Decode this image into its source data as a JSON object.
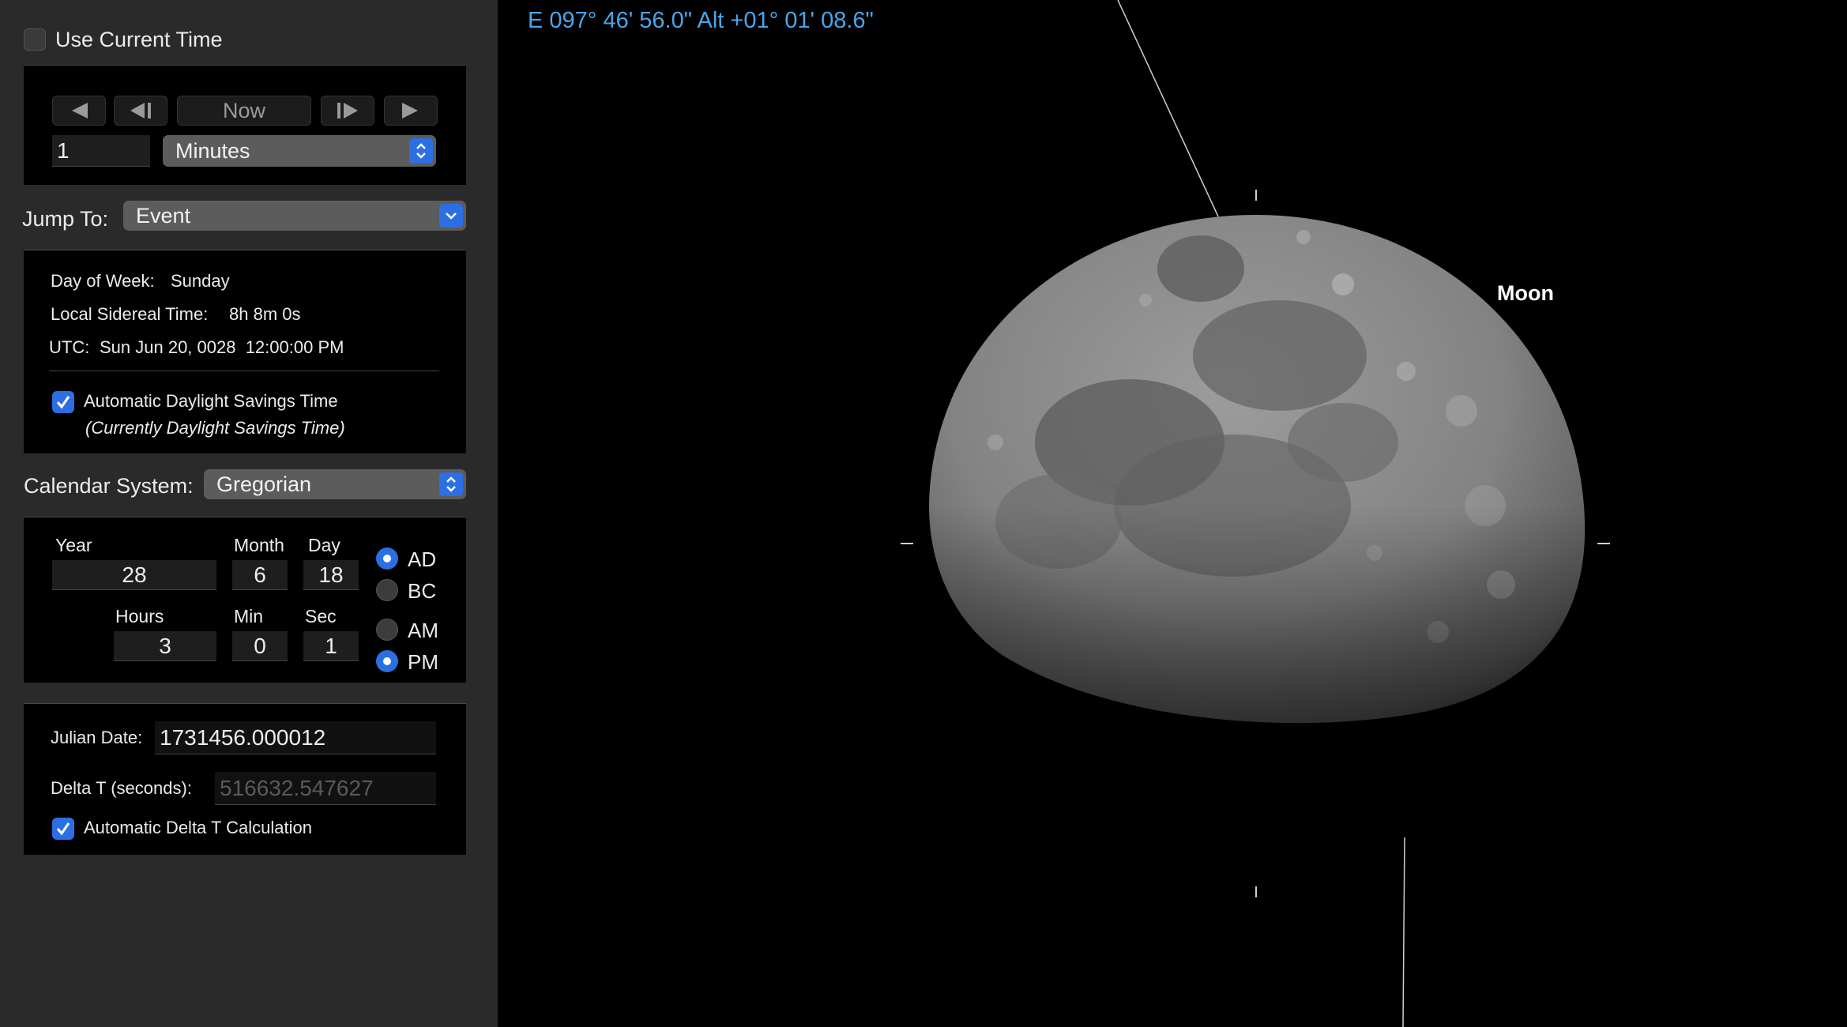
{
  "use_current_time": {
    "label": "Use Current Time",
    "checked": false
  },
  "step_controls": {
    "now_label": "Now",
    "step_amount": "1",
    "step_unit": "Minutes"
  },
  "jump_to": {
    "label": "Jump To:",
    "value": "Event"
  },
  "info": {
    "day_of_week_label": "Day of Week:",
    "day_of_week": "Sunday",
    "sidereal_label": "Local Sidereal Time:",
    "sidereal": "8h 8m 0s",
    "utc_label": "UTC:",
    "utc": "Sun Jun 20, 0028  12:00:00 PM",
    "auto_dst_label": "Automatic Daylight Savings Time",
    "auto_dst_checked": true,
    "dst_note": "(Currently Daylight Savings Time)"
  },
  "calendar": {
    "label": "Calendar System:",
    "value": "Gregorian"
  },
  "date": {
    "year_label": "Year",
    "year": "28",
    "month_label": "Month",
    "month": "6",
    "day_label": "Day",
    "day": "18",
    "hours_label": "Hours",
    "hours": "3",
    "min_label": "Min",
    "min": "0",
    "sec_label": "Sec",
    "sec": "1",
    "ad_label": "AD",
    "bc_label": "BC",
    "era": "AD",
    "am_label": "AM",
    "pm_label": "PM",
    "meridiem": "PM"
  },
  "julian": {
    "julian_label": "Julian Date:",
    "julian_value": "1731456.000012",
    "delta_t_label": "Delta T (seconds):",
    "delta_t_value": "516632.547627",
    "auto_delta_label": "Automatic Delta T Calculation",
    "auto_delta_checked": true
  },
  "sky": {
    "coordinates": "E 097° 46' 56.0\" Alt +01° 01' 08.6\"",
    "object_label": "Moon",
    "phase_illuminated": 0.62
  },
  "colors": {
    "accent": "#2b6fe3",
    "coord_text": "#4aa6e8",
    "panel_bg": "#2a2a2a"
  }
}
